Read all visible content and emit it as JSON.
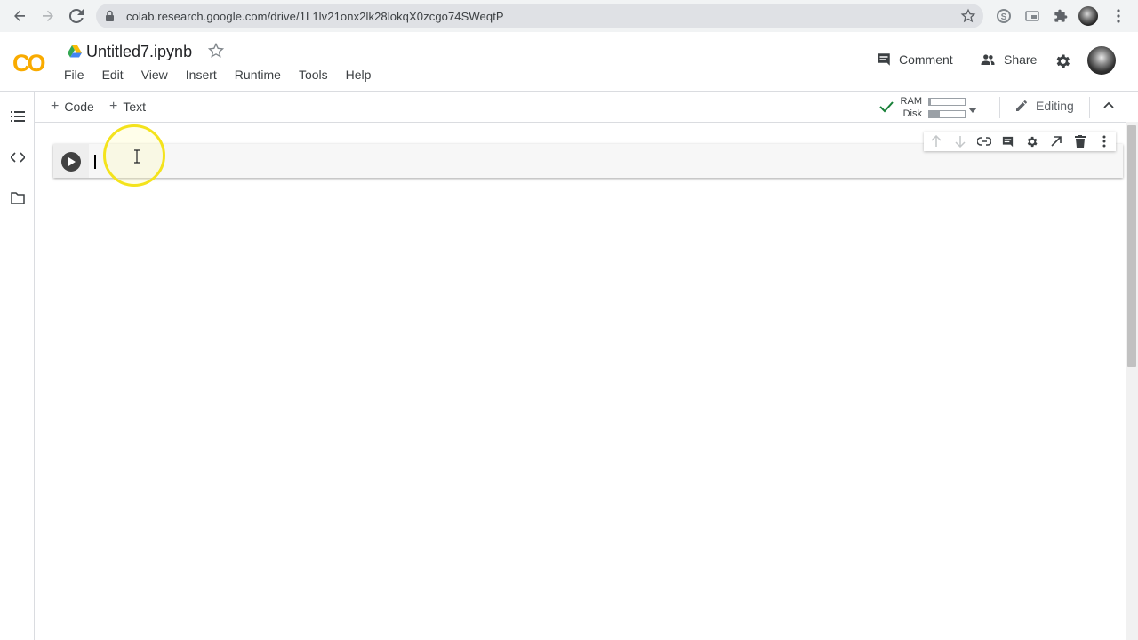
{
  "browser": {
    "url": "colab.research.google.com/drive/1L1lv21onx2lk28lokqX0zcgo74SWeqtP",
    "icons": [
      "back-arrow-icon",
      "forward-arrow-icon",
      "reload-icon",
      "lock-icon",
      "bookmark-star-icon",
      "skype-extension-icon",
      "cast-extension-icon",
      "extensions-puzzle-icon",
      "profile-avatar",
      "browser-menu-icon"
    ]
  },
  "header": {
    "logo_text": "CO",
    "logo_color": "#f9ab00",
    "notebook_title": "Untitled7.ipynb",
    "menu": [
      "File",
      "Edit",
      "View",
      "Insert",
      "Runtime",
      "Tools",
      "Help"
    ],
    "comment_label": "Comment",
    "share_label": "Share"
  },
  "toolbar": {
    "add_code_label": "Code",
    "add_text_label": "Text",
    "plus": "+",
    "ram_label": "RAM",
    "disk_label": "Disk",
    "ram_usage_fraction": 0.05,
    "disk_usage_fraction": 0.3,
    "editing_label": "Editing"
  },
  "sidebar": {
    "items": [
      "table-of-contents-icon",
      "code-snippets-icon",
      "files-folder-icon"
    ]
  },
  "cell": {
    "type": "code",
    "content": "",
    "toolbar_icons": [
      "move-up-icon",
      "move-down-icon",
      "link-icon",
      "comment-icon",
      "settings-icon",
      "mirror-cell-icon",
      "delete-icon",
      "more-options-icon"
    ]
  },
  "colors": {
    "accent": "#f9ab00",
    "text": "#202124",
    "muted": "#5f6368",
    "cursor_highlight": "#f4e31c"
  }
}
